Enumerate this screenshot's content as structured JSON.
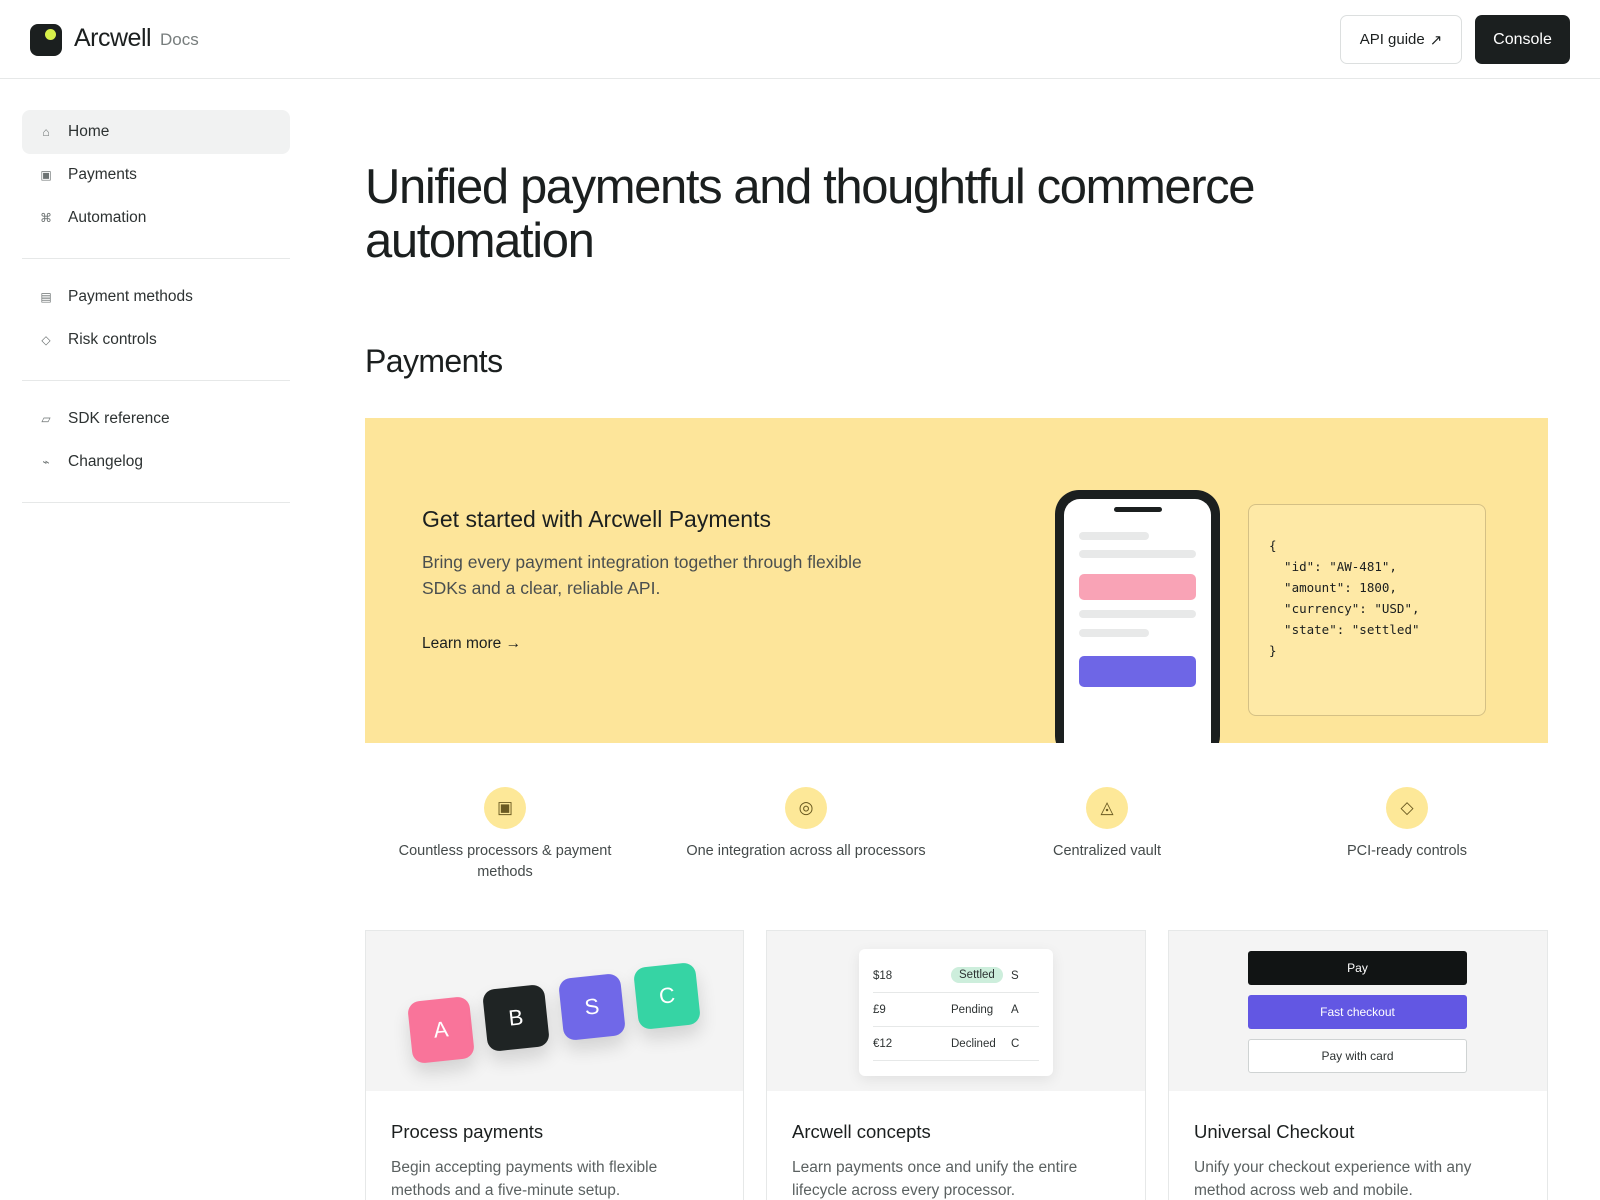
{
  "header": {
    "brand": "Arcwell",
    "brand_sub": "Docs",
    "api_guide_label": "API guide",
    "api_guide_arrow": "↗",
    "console_label": "Console"
  },
  "sidebar": {
    "items": [
      {
        "label": "Home",
        "icon": "home-icon",
        "glyph": "⌂",
        "active": true
      },
      {
        "label": "Payments",
        "icon": "payments-icon",
        "glyph": "▣"
      },
      {
        "label": "Automation",
        "icon": "command-icon",
        "glyph": "⌘"
      },
      {
        "label": "Payment methods",
        "icon": "list-icon",
        "glyph": "▤"
      },
      {
        "label": "Risk controls",
        "icon": "diamond-icon",
        "glyph": "◇"
      },
      {
        "label": "SDK reference",
        "icon": "sdk-icon",
        "glyph": "▱"
      },
      {
        "label": "Changelog",
        "icon": "changelog-icon",
        "glyph": "⌁"
      }
    ]
  },
  "main": {
    "hero_title": "Unified payments and thoughtful commerce automation",
    "section_title": "Payments",
    "banner": {
      "title": "Get started with Arcwell Payments",
      "description": "Bring every payment integration together through flexible SDKs and a clear, reliable API.",
      "link": "Learn more →",
      "code": "{\n  \"id\": \"AW-481\",\n  \"amount\": 1800,\n  \"currency\": \"USD\",\n  \"state\": \"settled\"\n}"
    },
    "features": [
      {
        "text": "Countless processors & payment methods",
        "icon": "processor-icon",
        "glyph": "▣"
      },
      {
        "text": "One integration across all processors",
        "icon": "target-icon",
        "glyph": "◎"
      },
      {
        "text": "Centralized vault",
        "icon": "vault-icon",
        "glyph": "◬"
      },
      {
        "text": "PCI-ready controls",
        "icon": "diamond-icon",
        "glyph": "◇"
      }
    ],
    "cards": [
      {
        "title": "Process payments",
        "desc": "Begin accepting payments with flexible methods and a five-minute setup.",
        "tiles": [
          {
            "letter": "A",
            "color": "#f9749a"
          },
          {
            "letter": "B",
            "color": "#1f2424"
          },
          {
            "letter": "S",
            "color": "#7068e8"
          },
          {
            "letter": "C",
            "color": "#36d4a4"
          }
        ]
      },
      {
        "title": "Arcwell concepts",
        "desc": "Learn payments once and unify the entire lifecycle across every processor.",
        "rows": [
          {
            "amount": "$18",
            "status": "Settled",
            "proc": "S"
          },
          {
            "amount": "£9",
            "status": "Pending",
            "proc": "A"
          },
          {
            "amount": "€12",
            "status": "Declined",
            "proc": "C"
          }
        ]
      },
      {
        "title": "Universal Checkout",
        "desc": "Unify your checkout experience with any method across web and mobile.",
        "buttons": [
          "Pay",
          "Fast checkout",
          "Pay with card"
        ]
      }
    ]
  },
  "colors": {
    "accent": "#fde59a",
    "dark": "#1b1f1f",
    "brand_dot": "#d7f04a",
    "purple": "#6e66e6",
    "pink": "#f9a3b6"
  }
}
